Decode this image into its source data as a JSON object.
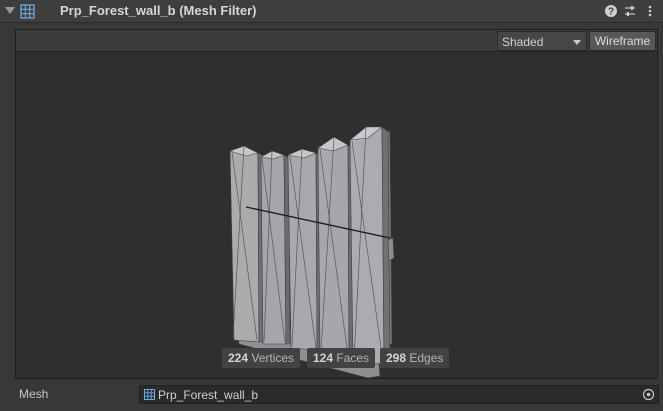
{
  "header": {
    "title": "Prp_Forest_wall_b (Mesh Filter)",
    "icons": [
      "foldout-arrow-icon",
      "mesh-filter-icon",
      "help-icon",
      "presets-icon",
      "context-menu-icon"
    ]
  },
  "preview": {
    "shading_mode": "Shaded",
    "wireframe_label": "Wireframe",
    "stats": {
      "vertices_count": "224",
      "vertices_label": "Vertices",
      "faces_count": "124",
      "faces_label": "Faces",
      "edges_count": "298",
      "edges_label": "Edges"
    }
  },
  "mesh_property": {
    "label": "Mesh",
    "value": "Prp_Forest_wall_b"
  },
  "colors": {
    "background": "#383838",
    "preview_background": "#2f2f2f",
    "mesh_fill": "#a7a7ab",
    "mesh_shadow": "#6e6e74",
    "icon_accent": "#6fa9e6"
  }
}
